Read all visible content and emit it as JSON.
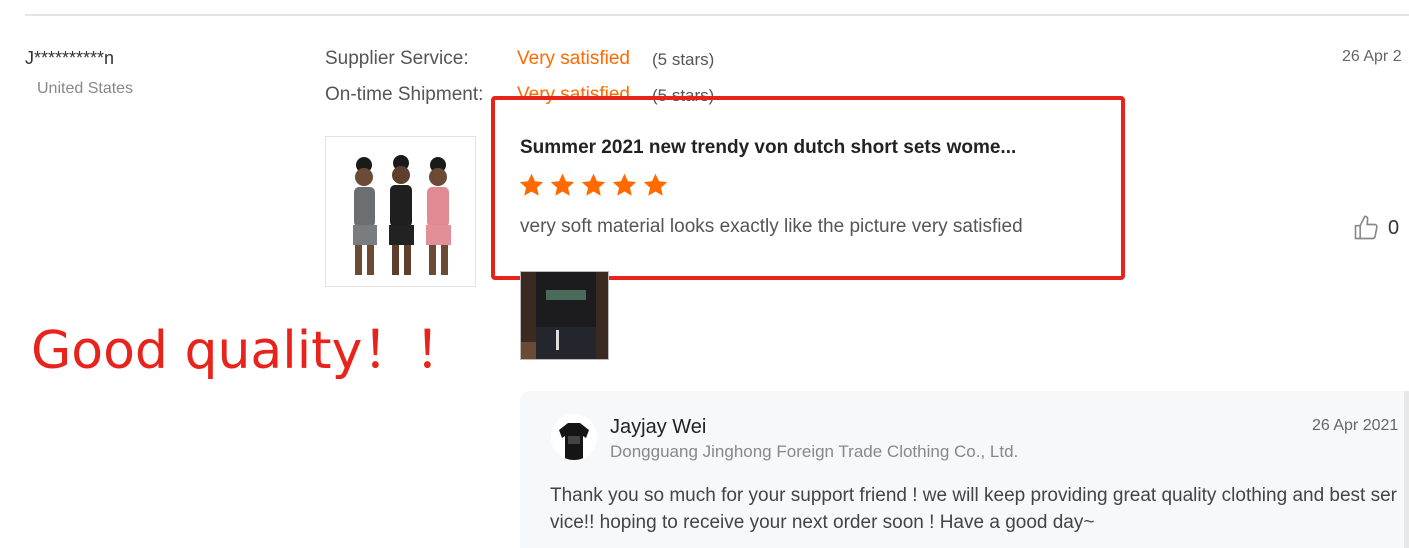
{
  "reviewer": {
    "name": "J**********n",
    "country": "United States",
    "date": "26 Apr 2"
  },
  "ratings": [
    {
      "label": "Supplier Service:",
      "value": "Very satisfied",
      "stars": "(5 stars)"
    },
    {
      "label": "On-time Shipment:",
      "value": "Very satisfied",
      "stars": "(5 stars)"
    }
  ],
  "review": {
    "product_title": "Summer 2021 new trendy von dutch short sets wome...",
    "rating": 5,
    "text": "very soft material looks exactly like the picture very satisfied",
    "likes": "0"
  },
  "overlay": {
    "text": "Good quality！！"
  },
  "reply": {
    "name": "Jayjay Wei",
    "company": "Dongguang Jinghong Foreign Trade Clothing Co., Ltd.",
    "date": "26 Apr 2021",
    "text": "Thank you so much for your support friend ! we will keep providing great quality clothing and best service!! hoping to receive your next order soon ! Have a good day~"
  },
  "colors": {
    "accent": "#ff6a00",
    "highlight": "#e8231b",
    "star": "#ff6a00"
  },
  "icons": {
    "like": "thumbs-up-icon",
    "star": "star-icon"
  }
}
